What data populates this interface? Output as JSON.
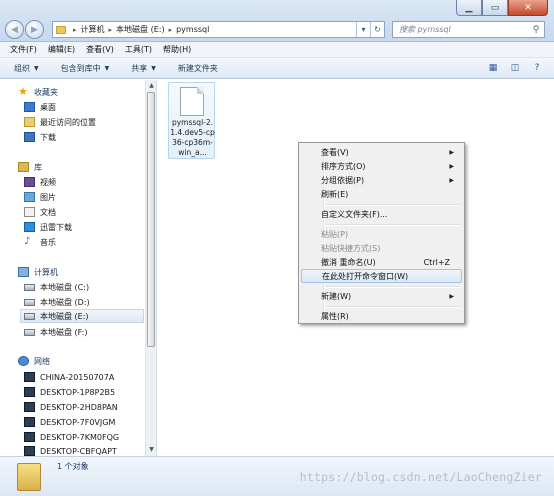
{
  "address": {
    "crumbs": [
      "计算机",
      "本地磁盘 (E:)",
      "pymssql"
    ],
    "separator": "▸"
  },
  "search": {
    "placeholder": "搜索 pymssql"
  },
  "menubar": [
    "文件(F)",
    "编辑(E)",
    "查看(V)",
    "工具(T)",
    "帮助(H)"
  ],
  "commandbar": [
    "组织",
    "包含到库中",
    "共享",
    "新建文件夹"
  ],
  "nav": {
    "favorites": {
      "label": "收藏夹",
      "items": [
        "桌面",
        "最近访问的位置",
        "下载"
      ]
    },
    "libraries": {
      "label": "库",
      "items": [
        "视频",
        "图片",
        "文档",
        "迅雷下载",
        "音乐"
      ]
    },
    "computer": {
      "label": "计算机",
      "items": [
        "本地磁盘 (C:)",
        "本地磁盘 (D:)",
        "本地磁盘 (E:)",
        "本地磁盘 (F:)"
      ],
      "selected": "本地磁盘 (E:)"
    },
    "network": {
      "label": "网络",
      "items": [
        "CHINA-20150707A",
        "DESKTOP-1P8P2B5",
        "DESKTOP-2HD8PAN",
        "DESKTOP-7F0VJGM",
        "DESKTOP-7KM0FQG",
        "DESKTOP-CBFQAPT"
      ]
    }
  },
  "file": {
    "name": "pymssql-2.1.4.dev5-cp36-cp36m-win_a..."
  },
  "context_menu": {
    "items": [
      {
        "label": "查看(V)",
        "submenu": true
      },
      {
        "label": "排序方式(O)",
        "submenu": true
      },
      {
        "label": "分组依据(P)",
        "submenu": true
      },
      {
        "label": "刷新(E)"
      },
      {
        "label": "自定义文件夹(F)..."
      },
      {
        "label": "粘贴(P)",
        "disabled": true
      },
      {
        "label": "粘贴快捷方式(S)",
        "disabled": true
      },
      {
        "label": "撤消 重命名(U)",
        "shortcut": "Ctrl+Z"
      },
      {
        "label": "在此处打开命令窗口(W)",
        "highlighted": true
      },
      {
        "label": "新建(W)",
        "submenu": true
      },
      {
        "label": "属性(R)"
      }
    ]
  },
  "status": {
    "count_text": "1 个对象"
  },
  "watermark": "https://blog.csdn.net/LaoChengZier"
}
